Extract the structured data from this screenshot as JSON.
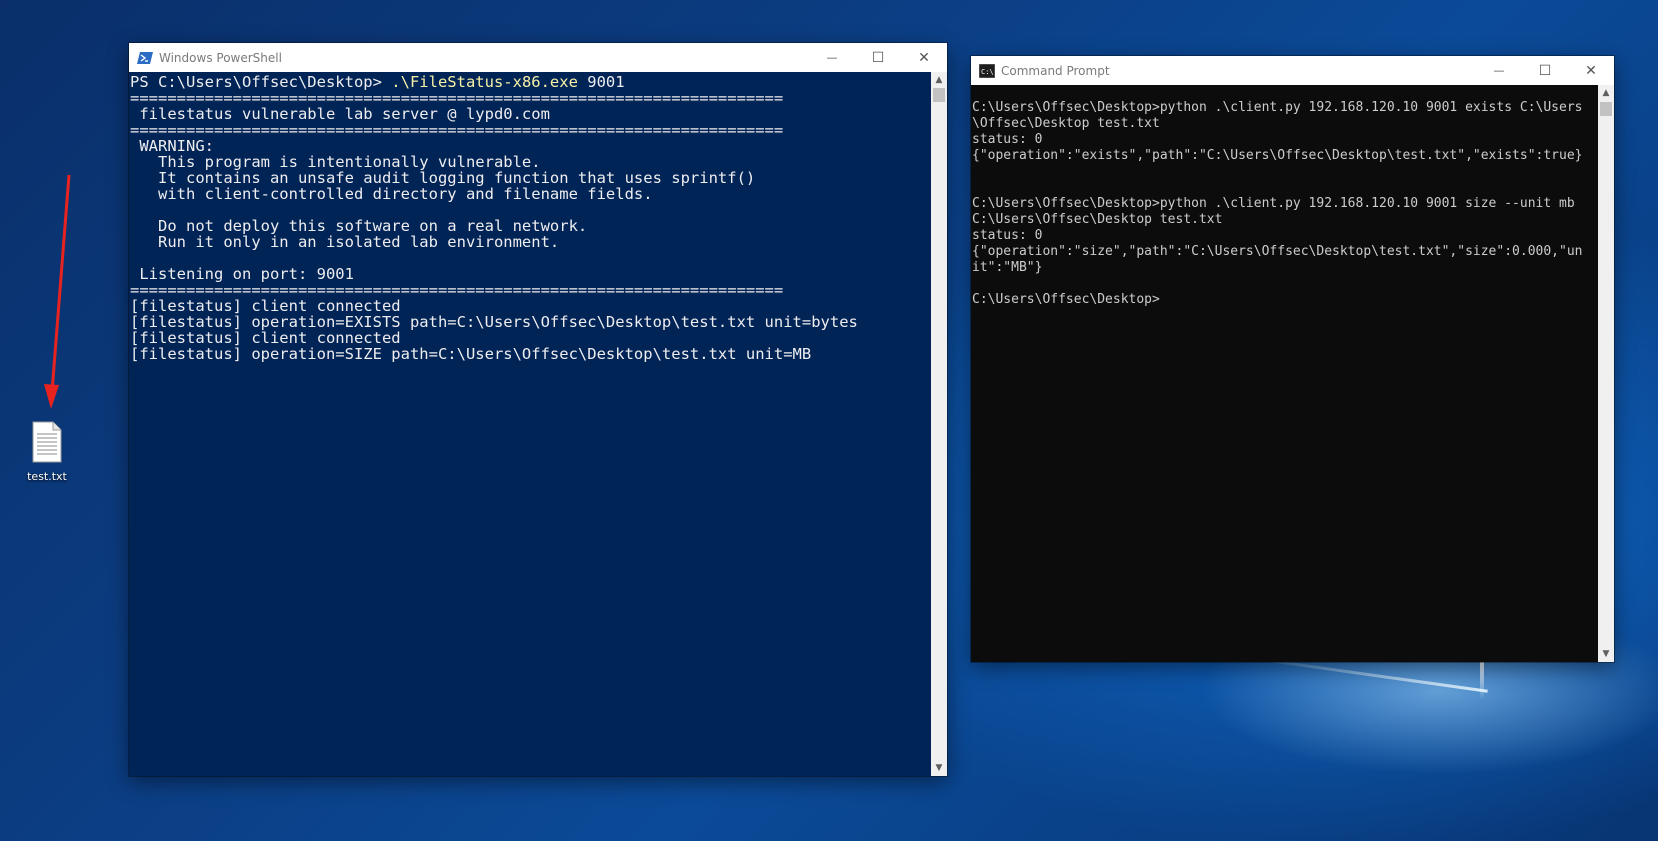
{
  "desktop": {
    "icon_label": "test.txt"
  },
  "powershell": {
    "title": "Windows PowerShell",
    "prompt": "PS C:\\Users\\Offsec\\Desktop> ",
    "command": ".\\FileStatus-x86.exe",
    "command_arg": " 9001",
    "output": "======================================================================\n filestatus vulnerable lab server @ lypd0.com\n======================================================================\n WARNING:\n   This program is intentionally vulnerable.\n   It contains an unsafe audit logging function that uses sprintf()\n   with client-controlled directory and filename fields.\n\n   Do not deploy this software on a real network.\n   Run it only in an isolated lab environment.\n\n Listening on port: 9001\n======================================================================\n[filestatus] client connected\n[filestatus] operation=EXISTS path=C:\\Users\\Offsec\\Desktop\\test.txt unit=bytes\n[filestatus] client connected\n[filestatus] operation=SIZE path=C:\\Users\\Offsec\\Desktop\\test.txt unit=MB"
  },
  "cmd": {
    "title": "Command Prompt",
    "output": "C:\\Users\\Offsec\\Desktop>python .\\client.py 192.168.120.10 9001 exists C:\\Users\n\\Offsec\\Desktop test.txt\nstatus: 0\n{\"operation\":\"exists\",\"path\":\"C:\\Users\\Offsec\\Desktop\\test.txt\",\"exists\":true}\n\n\nC:\\Users\\Offsec\\Desktop>python .\\client.py 192.168.120.10 9001 size --unit mb\nC:\\Users\\Offsec\\Desktop test.txt\nstatus: 0\n{\"operation\":\"size\",\"path\":\"C:\\Users\\Offsec\\Desktop\\test.txt\",\"size\":0.000,\"un\nit\":\"MB\"}\n\nC:\\Users\\Offsec\\Desktop>"
  },
  "window_controls": {
    "minimize": "—",
    "maximize": "☐",
    "close": "✕"
  },
  "colors": {
    "powershell_bg": "#012456",
    "cmd_bg": "#0c0c0c",
    "annotation_arrow": "#e8231f"
  }
}
